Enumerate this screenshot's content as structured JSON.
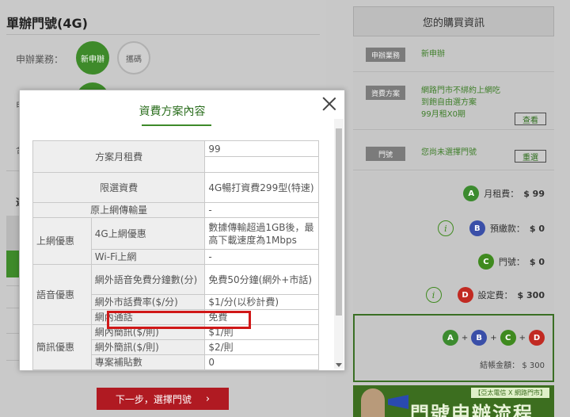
{
  "page": {
    "title": "單辦門號(4G)"
  },
  "service": {
    "label": "申辦業務：",
    "options": [
      {
        "label": "新申辦",
        "selected": true
      },
      {
        "label": "攜碼",
        "selected": false
      }
    ]
  },
  "background_fragments": {
    "frag1": "申",
    "frag2": "合",
    "frag3": "選"
  },
  "next_button": {
    "label": "下一步，選擇門號",
    "arrow": "›"
  },
  "sidebar": {
    "title": "您的購買資訊",
    "business": {
      "tag": "申辦業務",
      "value": "新申辦"
    },
    "plan": {
      "tag": "資費方案",
      "line1": "網路門市不綁約上網吃",
      "line2": "到飽自由選方案",
      "line3": "99月租X0期",
      "button": "查看"
    },
    "number": {
      "tag": "門號",
      "value": "您尚未選擇門號",
      "button": "重選"
    },
    "fees": [
      {
        "badge": "A",
        "label": "月租費：",
        "amount": "$ 99",
        "info": false
      },
      {
        "badge": "B",
        "label": "預繳款：",
        "amount": "$ 0",
        "info": true
      },
      {
        "badge": "C",
        "label": "門號：",
        "amount": "$ 0",
        "info": false
      },
      {
        "badge": "D",
        "label": "設定費：",
        "amount": "$ 300",
        "info": true
      }
    ],
    "sum": {
      "a": "A",
      "b": "B",
      "c": "C",
      "d": "D",
      "plus": "+",
      "equals": "="
    },
    "total": {
      "label": "結帳金額：",
      "amount": "$ 300"
    },
    "banner": {
      "tag": "【亞太電信 X 網路門市】",
      "big": "門號申辦流程"
    }
  },
  "modal": {
    "title": "資費方案內容",
    "rows": {
      "monthly": {
        "label": "方案月租費",
        "value": "99"
      },
      "limited": {
        "label": "限選資費",
        "value": "4G暢打資費299型(特速)"
      },
      "transfer": {
        "label": "原上網傳輸量",
        "value": "-"
      },
      "data_group": "上網優惠",
      "data_4g": {
        "label": "4G上網優惠",
        "value": "數據傳輸超過1GB後，最高下載速度為1Mbps"
      },
      "wifi": {
        "label": "Wi-Fi上網",
        "value": "-"
      },
      "voice_group": "語音優惠",
      "voice_free": {
        "label": "網外語音免費分鐘數(分)",
        "value": "免費50分鐘(網外+市話)"
      },
      "voice_rate": {
        "label": "網外市話費率($/分)",
        "value": "$1/分(以秒計費)"
      },
      "voice_onnet": {
        "label": "網內通話",
        "value": "免費"
      },
      "sms_group": "簡訊優惠",
      "sms_on": {
        "label": "網內簡訊($/則)",
        "value": "$1/則"
      },
      "sms_off": {
        "label": "網外簡訊($/則)",
        "value": "$2/則"
      },
      "sms_free": {
        "label": "專案補貼數",
        "value": "0"
      }
    }
  }
}
